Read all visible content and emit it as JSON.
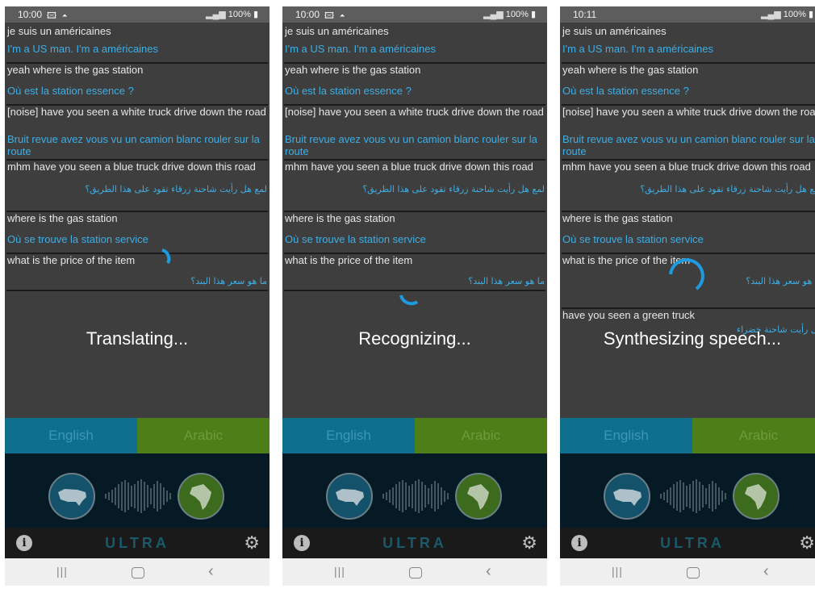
{
  "phones": [
    {
      "status_time": "10:00",
      "status_icons": "🖾 ⏶",
      "battery": "100%",
      "overlay_text": "Translating...",
      "conversation": [
        {
          "text": "je suis un américaines",
          "kind": "source"
        },
        {
          "text": "I'm a US man. I'm a américaines",
          "kind": "translation"
        },
        {
          "text": "yeah where is the gas station",
          "kind": "source"
        },
        {
          "text": "Où est la station essence ?",
          "kind": "translation"
        },
        {
          "text": "[noise] have you seen a white truck drive down the road",
          "kind": "source"
        },
        {
          "text": "Bruit revue avez vous vu un camion blanc rouler sur la route",
          "kind": "translation"
        },
        {
          "text": "mhm have you seen a blue truck drive down this road",
          "kind": "source"
        },
        {
          "text": "ﻟﻤﻊ ﻫﻞ ﺭﺃﻳﺖ ﺷﺎﺣﻨﺔ ﺯﺭﻗﺎﺀ ﺗﻘﻮﺩ ﻋﻠﻰ ﻫﺬﺍ ﺍﻟﻄﺮﻳﻖ؟",
          "kind": "translation-rtl"
        },
        {
          "text": "where is the gas station",
          "kind": "source"
        },
        {
          "text": "Où se trouve la station service",
          "kind": "translation"
        },
        {
          "text": "what is the price of the item",
          "kind": "source"
        },
        {
          "text": "ﻣﺎ ﻫﻮ ﺳﻌﺮ ﻫﺬﺍ ﺍﻟﺒﻨﺪ؟",
          "kind": "translation-rtl"
        }
      ],
      "lang_left": "English",
      "lang_right": "Arabic",
      "brand": "ULTRA"
    },
    {
      "status_time": "10:00",
      "status_icons": "🖾 ⏶",
      "battery": "100%",
      "overlay_text": "Recognizing...",
      "conversation": [
        {
          "text": "je suis un américaines",
          "kind": "source"
        },
        {
          "text": "I'm a US man. I'm a américaines",
          "kind": "translation"
        },
        {
          "text": "yeah where is the gas station",
          "kind": "source"
        },
        {
          "text": "Où est la station essence ?",
          "kind": "translation"
        },
        {
          "text": "[noise] have you seen a white truck drive down the road",
          "kind": "source"
        },
        {
          "text": "Bruit revue avez vous vu un camion blanc rouler sur la route",
          "kind": "translation"
        },
        {
          "text": "mhm have you seen a blue truck drive down this road",
          "kind": "source"
        },
        {
          "text": "ﻟﻤﻊ ﻫﻞ ﺭﺃﻳﺖ ﺷﺎﺣﻨﺔ ﺯﺭﻗﺎﺀ ﺗﻘﻮﺩ ﻋﻠﻰ ﻫﺬﺍ ﺍﻟﻄﺮﻳﻖ؟",
          "kind": "translation-rtl"
        },
        {
          "text": "where is the gas station",
          "kind": "source"
        },
        {
          "text": "Où se trouve la station service",
          "kind": "translation"
        },
        {
          "text": "what is the price of the item",
          "kind": "source"
        },
        {
          "text": "ﻣﺎ ﻫﻮ ﺳﻌﺮ ﻫﺬﺍ ﺍﻟﺒﻨﺪ؟",
          "kind": "translation-rtl"
        }
      ],
      "lang_left": "English",
      "lang_right": "Arabic",
      "brand": "ULTRA"
    },
    {
      "status_time": "10:11",
      "status_icons": "",
      "battery": "100%",
      "overlay_text": "Synthesizing speech...",
      "conversation": [
        {
          "text": "je suis un américaines",
          "kind": "source"
        },
        {
          "text": "I'm a US man. I'm a américaines",
          "kind": "translation"
        },
        {
          "text": "yeah where is the gas station",
          "kind": "source"
        },
        {
          "text": "Où est la station essence ?",
          "kind": "translation"
        },
        {
          "text": "[noise] have you seen a white truck drive down the road",
          "kind": "source"
        },
        {
          "text": "Bruit revue avez vous vu un camion blanc rouler sur la route",
          "kind": "translation"
        },
        {
          "text": "mhm have you seen a blue truck drive down this road",
          "kind": "source"
        },
        {
          "text": "ﻟﻤﻊ ﻫﻞ ﺭﺃﻳﺖ ﺷﺎﺣﻨﺔ ﺯﺭﻗﺎﺀ ﺗﻘﻮﺩ ﻋﻠﻰ ﻫﺬﺍ ﺍﻟﻄﺮﻳﻖ؟",
          "kind": "translation-rtl"
        },
        {
          "text": "where is the gas station",
          "kind": "source"
        },
        {
          "text": "Où se trouve la station service",
          "kind": "translation"
        },
        {
          "text": "what is the price of the item",
          "kind": "source"
        },
        {
          "text": "ﻣﺎ ﻫﻮ ﺳﻌﺮ ﻫﺬﺍ ﺍﻟﺒﻨﺪ؟",
          "kind": "translation-rtl"
        },
        {
          "text": "have you seen a green truck",
          "kind": "source"
        },
        {
          "text": "ﻫﻞ ﺭﺃﻳﺖ ﺷﺎﺣﻨﺔ ﺧﻀﺮﺍﺀ",
          "kind": "translation-rtl"
        }
      ],
      "lang_left": "English",
      "lang_right": "Arabic",
      "brand": "ULTRA"
    }
  ],
  "colors": {
    "english_bar": "#0f6f8e",
    "arabic_bar": "#4d7f18",
    "translation_text": "#3dafe6",
    "spinner": "#1e9be0"
  },
  "icons": {
    "info": "info-icon",
    "settings": "gear-icon",
    "mic_english": "us-map-icon",
    "mic_arabic": "africa-map-icon",
    "nav_recents": "recents-icon",
    "nav_home": "home-icon",
    "nav_back": "back-icon"
  }
}
